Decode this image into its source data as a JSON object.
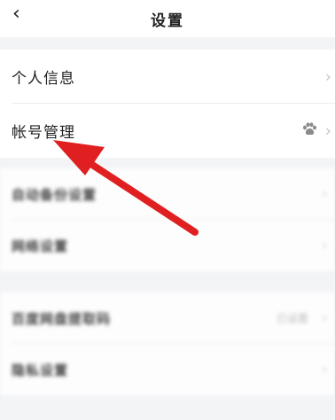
{
  "header": {
    "back_icon": "‹",
    "title": "设置"
  },
  "section_main": {
    "items": [
      {
        "label": "个人信息"
      },
      {
        "label": "帐号管理"
      }
    ]
  },
  "section_blurred_1": {
    "items": [
      {
        "label": "自动备份设置"
      },
      {
        "label": "网络设置"
      }
    ]
  },
  "section_blurred_2": {
    "items": [
      {
        "label": "百度网盘提取码",
        "value": "已设置"
      },
      {
        "label": "隐私设置"
      }
    ]
  },
  "chevron": "›",
  "annotation": {
    "arrow_color": "#e02020"
  }
}
